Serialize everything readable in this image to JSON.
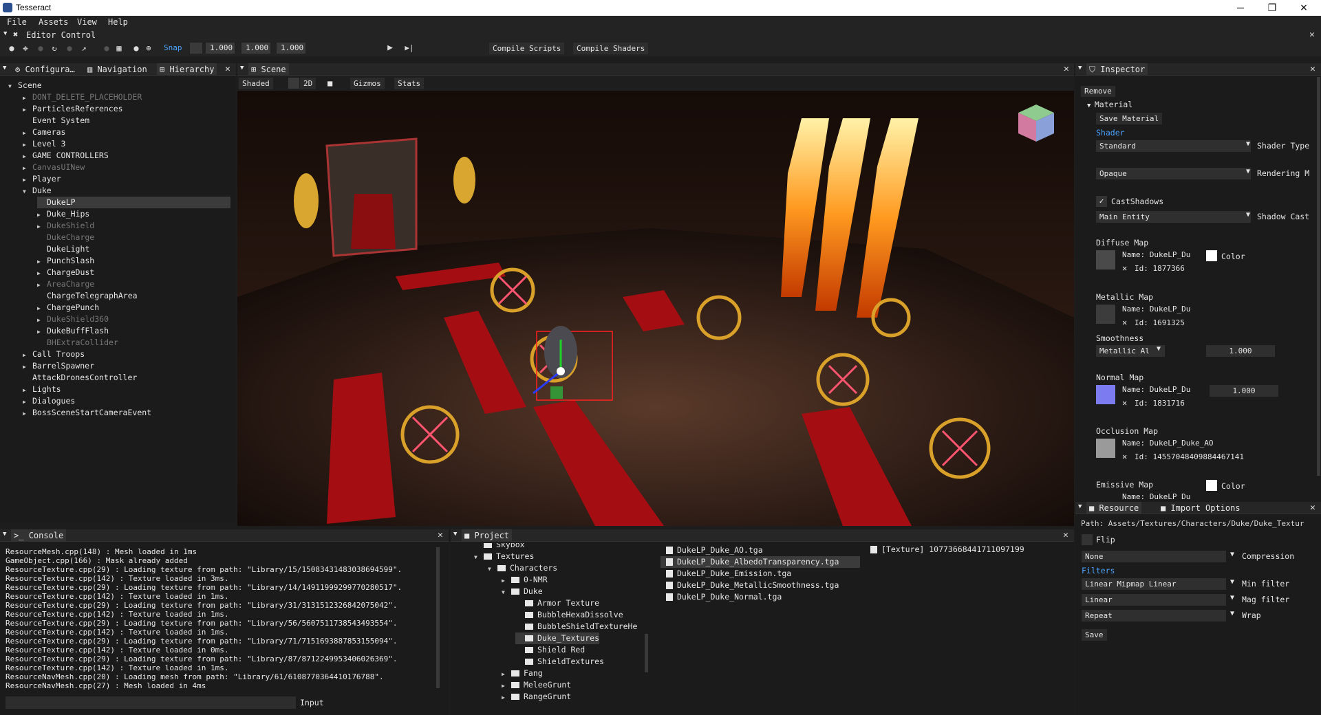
{
  "window": {
    "title": "Tesseract",
    "minimize": "─",
    "maximize": "❐",
    "close": "✕"
  },
  "menu": [
    "File",
    "Assets",
    "View",
    "Help"
  ],
  "editor_control": {
    "label": "Editor Control"
  },
  "toolbar": {
    "snap": "Snap",
    "values": [
      "1.000",
      "1.000",
      "1.000"
    ],
    "compile_scripts": "Compile Scripts",
    "compile_shaders": "Compile Shaders"
  },
  "left_tabs": [
    "Configura…",
    "Navigation",
    "Hierarchy"
  ],
  "hierarchy": [
    {
      "label": "Scene",
      "arrow": "▼",
      "depth": 0,
      "dim": false
    },
    {
      "label": "DONT_DELETE_PLACEHOLDER",
      "arrow": "▶",
      "depth": 1,
      "dim": true
    },
    {
      "label": "ParticlesReferences",
      "arrow": "▶",
      "depth": 1,
      "dim": false
    },
    {
      "label": "Event System",
      "arrow": "",
      "depth": 1,
      "dim": false
    },
    {
      "label": "Cameras",
      "arrow": "▶",
      "depth": 1,
      "dim": false
    },
    {
      "label": "Level 3",
      "arrow": "▶",
      "depth": 1,
      "dim": false
    },
    {
      "label": "GAME CONTROLLERS",
      "arrow": "▶",
      "depth": 1,
      "dim": false
    },
    {
      "label": "CanvasUINew",
      "arrow": "▶",
      "depth": 1,
      "dim": true
    },
    {
      "label": "Player",
      "arrow": "▶",
      "depth": 1,
      "dim": false
    },
    {
      "label": "Duke",
      "arrow": "▼",
      "depth": 1,
      "dim": false
    },
    {
      "label": "DukeLP",
      "arrow": "",
      "depth": 2,
      "dim": false,
      "selected": true
    },
    {
      "label": "Duke_Hips",
      "arrow": "▶",
      "depth": 2,
      "dim": false
    },
    {
      "label": "DukeShield",
      "arrow": "▶",
      "depth": 2,
      "dim": true
    },
    {
      "label": "DukeCharge",
      "arrow": "",
      "depth": 2,
      "dim": true
    },
    {
      "label": "DukeLight",
      "arrow": "",
      "depth": 2,
      "dim": false
    },
    {
      "label": "PunchSlash",
      "arrow": "▶",
      "depth": 2,
      "dim": false
    },
    {
      "label": "ChargeDust",
      "arrow": "▶",
      "depth": 2,
      "dim": false
    },
    {
      "label": "AreaCharge",
      "arrow": "▶",
      "depth": 2,
      "dim": true
    },
    {
      "label": "ChargeTelegraphArea",
      "arrow": "",
      "depth": 2,
      "dim": false
    },
    {
      "label": "ChargePunch",
      "arrow": "▶",
      "depth": 2,
      "dim": false
    },
    {
      "label": "DukeShield360",
      "arrow": "▶",
      "depth": 2,
      "dim": true
    },
    {
      "label": "DukeBuffFlash",
      "arrow": "▶",
      "depth": 2,
      "dim": false
    },
    {
      "label": "BHExtraCollider",
      "arrow": "",
      "depth": 2,
      "dim": true
    },
    {
      "label": "Call Troops",
      "arrow": "▶",
      "depth": 1,
      "dim": false
    },
    {
      "label": "BarrelSpawner",
      "arrow": "▶",
      "depth": 1,
      "dim": false
    },
    {
      "label": "AttackDronesController",
      "arrow": "",
      "depth": 1,
      "dim": false
    },
    {
      "label": "Lights",
      "arrow": "▶",
      "depth": 1,
      "dim": false
    },
    {
      "label": "Dialogues",
      "arrow": "▶",
      "depth": 1,
      "dim": false
    },
    {
      "label": "BossSceneStartCameraEvent",
      "arrow": "▶",
      "depth": 1,
      "dim": false
    }
  ],
  "scene": {
    "tab": "Scene",
    "shaded": "Shaded",
    "mode2d": "2D",
    "gizmos": "Gizmos",
    "stats": "Stats"
  },
  "inspector": {
    "tab": "Inspector",
    "remove": "Remove",
    "material": "Material",
    "save_material": "Save Material",
    "shader": "Shader",
    "shader_value": "Standard",
    "shader_type": "Shader Type",
    "rendering_value": "Opaque",
    "rendering_label": "Rendering M",
    "cast_shadows": "CastShadows",
    "shadow_value": "Main Entity",
    "shadow_label": "Shadow Cast",
    "diffuse_map": "Diffuse Map",
    "diffuse_name": "Name: DukeLP_Du",
    "diffuse_id": "Id: 1877366",
    "color": "Color",
    "metallic_map": "Metallic Map",
    "metallic_name": "Name: DukeLP_Du",
    "metallic_id": "Id: 1691325",
    "smoothness": "Smoothness",
    "smoothness_source": "Metallic Al",
    "smoothness_value": "1.000",
    "normal_map": "Normal Map",
    "normal_name": "Name: DukeLP_Du",
    "normal_id": "Id: 1831716",
    "normal_value": "1.000",
    "occlusion_map": "Occlusion Map",
    "occlusion_name": "Name: DukeLP_Duke_AO",
    "occlusion_id": "Id: 14557048409884467141",
    "emissive_map": "Emissive Map",
    "emissive_name": "Name: DukeLP_Du",
    "emissive_color": "Color",
    "x": "✕"
  },
  "console": {
    "tab": "Console",
    "input_label": "Input",
    "lines": [
      "ResourceMesh.cpp(148) : Mesh loaded in 1ms",
      "GameObject.cpp(166) : Mask already added",
      "ResourceTexture.cpp(29) : Loading texture from path: \"Library/15/15083431483038694599\".",
      "ResourceTexture.cpp(142) : Texture loaded in 3ms.",
      "ResourceTexture.cpp(29) : Loading texture from path: \"Library/14/14911999299770280517\".",
      "ResourceTexture.cpp(142) : Texture loaded in 1ms.",
      "ResourceTexture.cpp(29) : Loading texture from path: \"Library/31/3131512326842075042\".",
      "ResourceTexture.cpp(142) : Texture loaded in 1ms.",
      "ResourceTexture.cpp(29) : Loading texture from path: \"Library/56/5607511738543493554\".",
      "ResourceTexture.cpp(142) : Texture loaded in 1ms.",
      "ResourceTexture.cpp(29) : Loading texture from path: \"Library/71/7151693887853155094\".",
      "ResourceTexture.cpp(142) : Texture loaded in 0ms.",
      "ResourceTexture.cpp(29) : Loading texture from path: \"Library/87/8712249953406026369\".",
      "ResourceTexture.cpp(142) : Texture loaded in 1ms.",
      "ResourceNavMesh.cpp(20) : Loading mesh from path: \"Library/61/6108770364410176788\".",
      "ResourceNavMesh.cpp(27) : Mesh loaded in 4ms"
    ]
  },
  "project": {
    "tab": "Project",
    "tree": [
      {
        "label": "Skybox",
        "arrow": "",
        "depth": 0
      },
      {
        "label": "Textures",
        "arrow": "▼",
        "depth": 0
      },
      {
        "label": "Characters",
        "arrow": "▼",
        "depth": 1
      },
      {
        "label": "0-NMR",
        "arrow": "▶",
        "depth": 2
      },
      {
        "label": "Duke",
        "arrow": "▼",
        "depth": 2
      },
      {
        "label": "Armor Texture",
        "arrow": "",
        "depth": 3
      },
      {
        "label": "BubbleHexaDissolve",
        "arrow": "",
        "depth": 3
      },
      {
        "label": "BubbleShieldTextureHe",
        "arrow": "",
        "depth": 3
      },
      {
        "label": "Duke_Textures",
        "arrow": "",
        "depth": 3,
        "selected": true
      },
      {
        "label": "Shield Red",
        "arrow": "",
        "depth": 3
      },
      {
        "label": "ShieldTextures",
        "arrow": "",
        "depth": 3
      },
      {
        "label": "Fang",
        "arrow": "▶",
        "depth": 2
      },
      {
        "label": "MeleeGrunt",
        "arrow": "▶",
        "depth": 2
      },
      {
        "label": "RangeGrunt",
        "arrow": "▶",
        "depth": 2
      }
    ],
    "files": [
      {
        "label": "DukeLP_Duke_AO.tga"
      },
      {
        "label": "DukeLP_Duke_AlbedoTransparency.tga",
        "selected": true
      },
      {
        "label": "DukeLP_Duke_Emission.tga"
      },
      {
        "label": "DukeLP_Duke_MetallicSmoothness.tga"
      },
      {
        "label": "DukeLP_Duke_Normal.tga"
      }
    ],
    "preview_item": "[Texture] 10773668441711097199"
  },
  "resource": {
    "tab1": "Resource",
    "tab2": "Import Options",
    "path": "Path: Assets/Textures/Characters/Duke/Duke_Textur",
    "flip": "Flip",
    "compression_value": "None",
    "compression_label": "Compression",
    "filters": "Filters",
    "min_value": "Linear Mipmap Linear",
    "min_label": "Min filter",
    "mag_value": "Linear",
    "mag_label": "Mag filter",
    "wrap_value": "Repeat",
    "wrap_label": "Wrap",
    "save": "Save"
  }
}
